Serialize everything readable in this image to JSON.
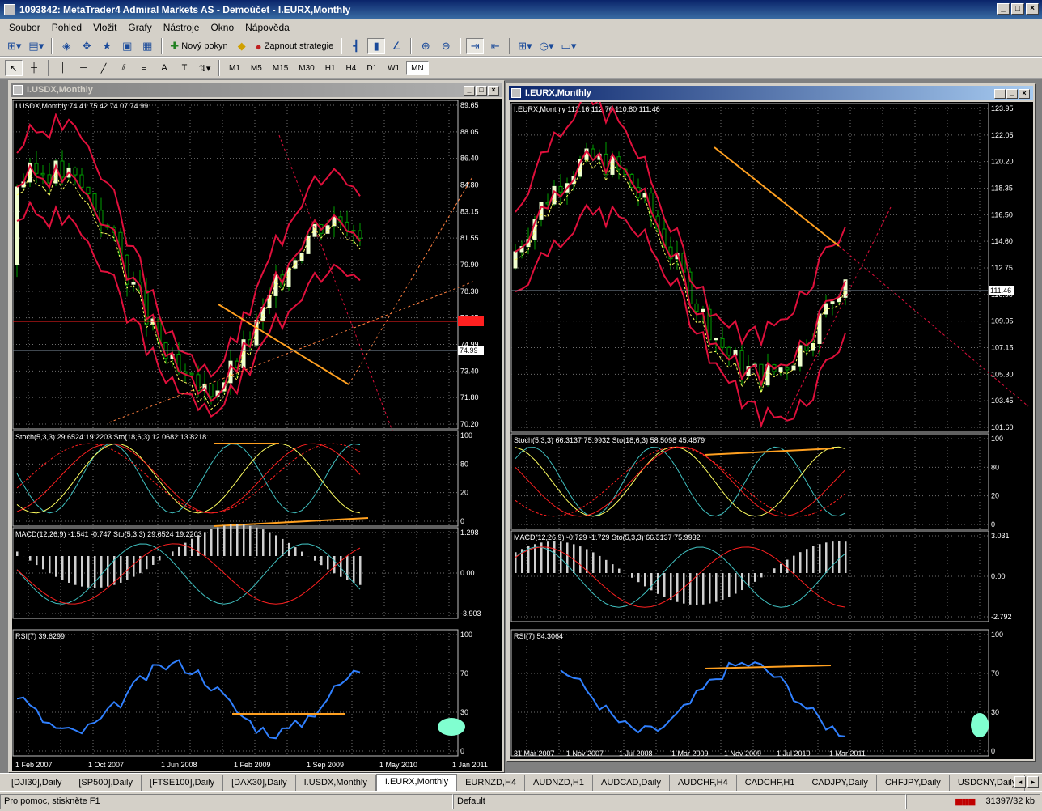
{
  "window": {
    "title": "1093842: MetaTrader4 Admiral Markets AS - Demoúčet - I.EURX,Monthly",
    "min": "_",
    "max": "□",
    "close": "×"
  },
  "menu": [
    "Soubor",
    "Pohled",
    "Vložit",
    "Grafy",
    "Nástroje",
    "Okno",
    "Nápověda"
  ],
  "toolbar": {
    "new_order": "Nový pokyn",
    "strategies": "Zapnout strategie"
  },
  "timeframes": [
    "M1",
    "M5",
    "M15",
    "M30",
    "H1",
    "H4",
    "D1",
    "W1",
    "MN"
  ],
  "active_timeframe": "MN",
  "charts": [
    {
      "window_title": "I.USDX,Monthly",
      "header": "I.USDX,Monthly  74.41 75.42 74.07 74.99",
      "price_axis": [
        "89.65",
        "88.05",
        "86.40",
        "84.80",
        "83.15",
        "81.55",
        "79.90",
        "78.30",
        "76.65",
        "74.99",
        "73.40",
        "71.80",
        "70.20"
      ],
      "current_price": "74.99",
      "stoch_label": "Stoch(5,3,3) 29.6524 19.2203   Sto(18,6,3) 12.0682 13.8218",
      "stoch_axis": [
        "100",
        "80",
        "20",
        "0"
      ],
      "macd_label": "MACD(12,26,9) -1.541 -0.747  Sto(5,3,3) 29.6524 19.2203",
      "macd_axis": [
        "1.298",
        "0.00",
        "-3.903"
      ],
      "rsi_label": "RSI(7) 39.6299",
      "rsi_axis": [
        "100",
        "70",
        "30",
        "0"
      ],
      "dates": [
        "1 Feb 2007",
        "1 Oct 2007",
        "1 Jun 2008",
        "1 Feb 2009",
        "1 Sep 2009",
        "1 May 2010",
        "1 Jan 2011"
      ]
    },
    {
      "window_title": "I.EURX,Monthly",
      "header": "I.EURX,Monthly  112.16 112.76 110.80 111.46",
      "price_axis": [
        "123.95",
        "122.05",
        "120.20",
        "118.35",
        "116.50",
        "114.60",
        "112.75",
        "110.90",
        "109.05",
        "107.15",
        "105.30",
        "103.45",
        "101.60"
      ],
      "current_price": "111.46",
      "stoch_label": "Stoch(5,3,3) 66.3137 75.9932   Sto(18,6,3) 58.5098 45.4879",
      "stoch_axis": [
        "100",
        "80",
        "20",
        "0"
      ],
      "macd_label": "MACD(12,26,9) -0.729 -1.729  Sto(5,3,3) 66.3137 75.9932",
      "macd_axis": [
        "3.031",
        "0.00",
        "-2.792"
      ],
      "rsi_label": "RSI(7) 54.3064",
      "rsi_axis": [
        "100",
        "70",
        "30",
        "0"
      ],
      "dates": [
        "31 Mar 2007",
        "1 Nov 2007",
        "1 Jul 2008",
        "1 Mar 2009",
        "1 Nov 2009",
        "1 Jul 2010",
        "1 Mar 2011"
      ]
    }
  ],
  "tabs": [
    "[DJI30],Daily",
    "[SP500],Daily",
    "[FTSE100],Daily",
    "[DAX30],Daily",
    "I.USDX,Monthly",
    "I.EURX,Monthly",
    "EURNZD,H4",
    "AUDNZD,H1",
    "AUDCAD,Daily",
    "AUDCHF,H4",
    "CADCHF,H1",
    "CADJPY,Daily",
    "CHFJPY,Daily",
    "USDCNY,Daily"
  ],
  "active_tab": "I.EURX,Monthly",
  "status": {
    "help": "Pro pomoc, stiskněte F1",
    "profile": "Default",
    "traffic": "31397/32 kb"
  },
  "colors": {
    "background": "#000000",
    "bull_candle": "#f0ffd0",
    "bear_candle": "#00a000",
    "bands": "#e0103c",
    "orange": "#ffa020",
    "rsi": "#3080ff",
    "grid": "#707070"
  }
}
